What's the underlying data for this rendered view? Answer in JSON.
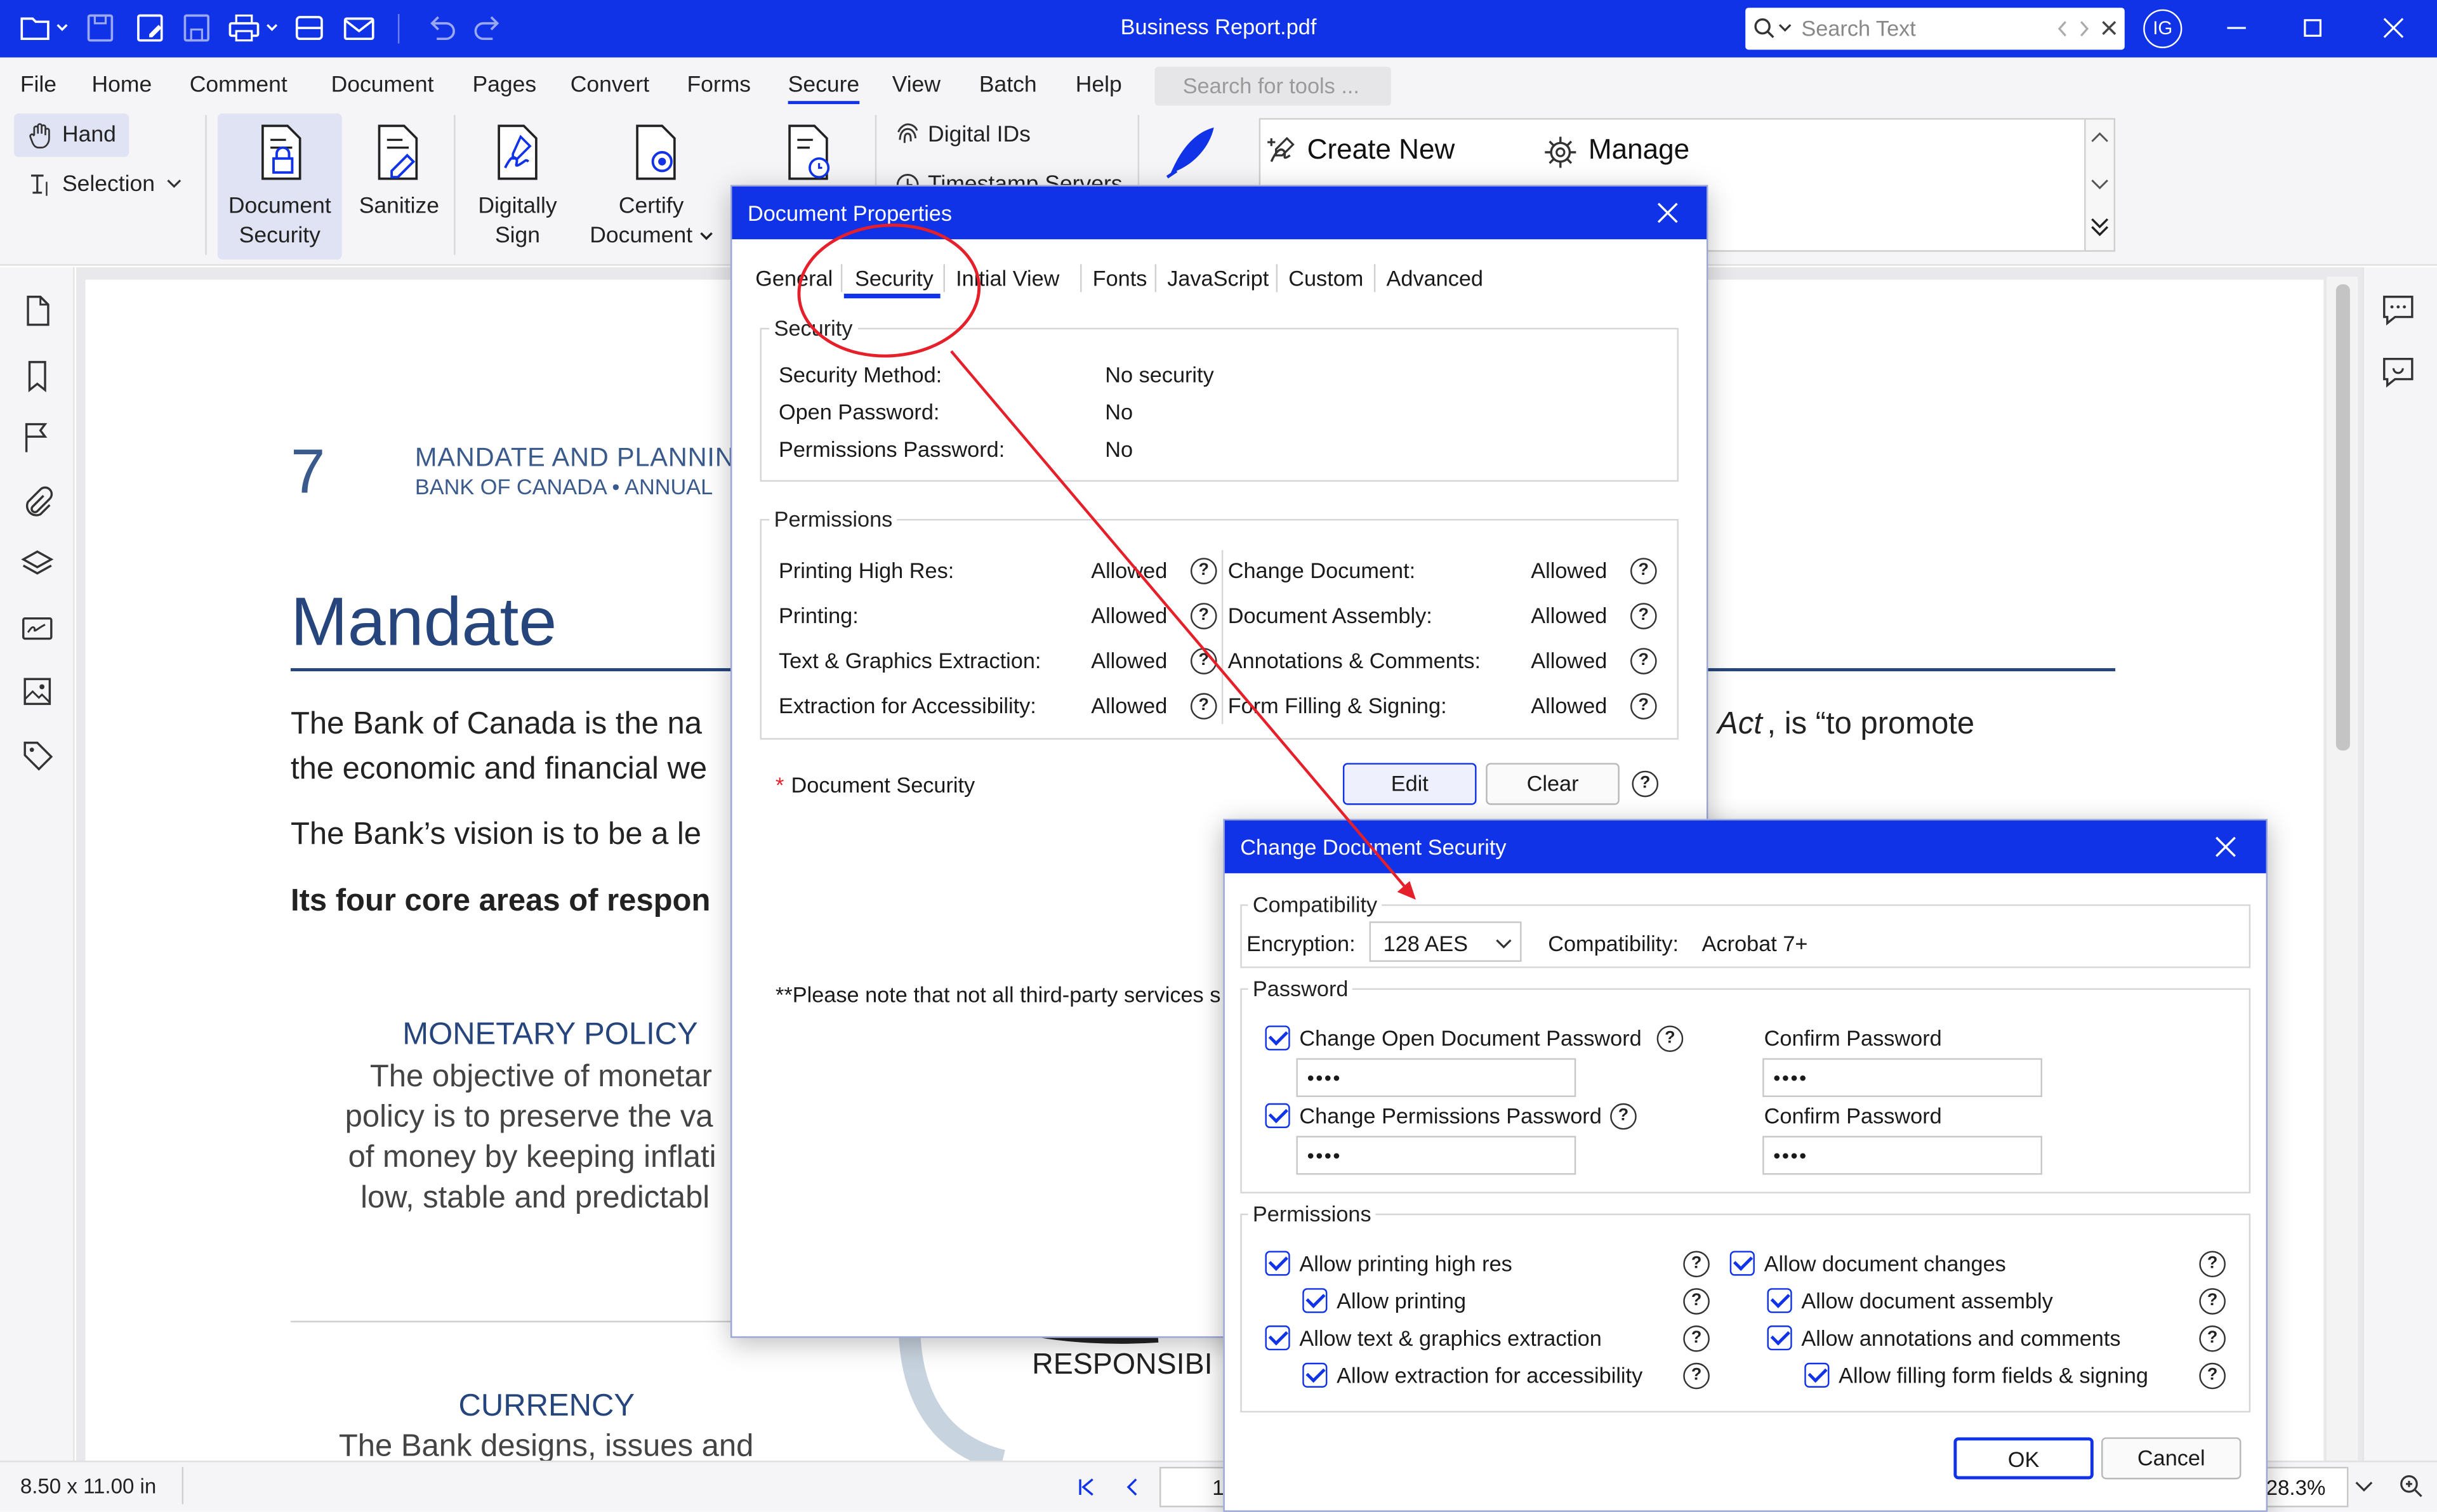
{
  "app": {
    "title": "Business Report.pdf",
    "search_placeholder": "Search Text",
    "avatar_initials": "IG",
    "accent": "#1033e8"
  },
  "menu": [
    "File",
    "Home",
    "Comment",
    "Document",
    "Pages",
    "Convert",
    "Forms",
    "Secure",
    "View",
    "Batch",
    "Help"
  ],
  "tools_search_placeholder": "Search for tools ...",
  "ribbon": {
    "hand": "Hand",
    "selection": "Selection",
    "document_security_1": "Document",
    "document_security_2": "Security",
    "sanitize": "Sanitize",
    "digitally_1": "Digitally",
    "digitally_2": "Sign",
    "certify_1": "Certify",
    "certify_2": "Document",
    "digital_ids": "Digital IDs",
    "timestamp_servers": "Timestamp Servers",
    "create_new": "Create New",
    "manage": "Manage"
  },
  "page": {
    "number": "7",
    "header1": "MANDATE AND PLANNIN",
    "header2": "BANK OF CANADA  •  ANNUAL",
    "heading": "Mandate",
    "p1a": "The Bank of Canada is the na",
    "p1b": "the economic and financial we",
    "p1c": "Act",
    "p1d": ", is “to promote",
    "p2": "The Bank’s vision is to be a le",
    "p3": "Its four core areas of respon",
    "mp_title": "MONETARY POLICY",
    "mp_l1": "The objective of monetar",
    "mp_l2": "policy is to preserve the va",
    "mp_l3": "of money by keeping inflati",
    "mp_l4": "low, stable and predictabl",
    "cur_title": "CURRENCY",
    "cur_l1": "The Bank designs, issues and",
    "resp": "RESPONSIBI"
  },
  "status": {
    "page_size": "8.50 x 11.00 in",
    "page_field": "1",
    "zoom": "28.3%"
  },
  "doc_properties": {
    "title": "Document Properties",
    "tabs": [
      "General",
      "Security",
      "Initial View",
      "Fonts",
      "JavaScript",
      "Custom",
      "Advanced"
    ],
    "active_tab": "Security",
    "security_legend": "Security",
    "security_rows": [
      {
        "label": "Security Method:",
        "value": "No security"
      },
      {
        "label": "Open Password:",
        "value": "No"
      },
      {
        "label": "Permissions Password:",
        "value": "No"
      }
    ],
    "permissions_legend": "Permissions",
    "perm_left": [
      {
        "label": "Printing High Res:",
        "value": "Allowed"
      },
      {
        "label": "Printing:",
        "value": "Allowed"
      },
      {
        "label": "Text & Graphics Extraction:",
        "value": "Allowed"
      },
      {
        "label": "Extraction for Accessibility:",
        "value": "Allowed"
      }
    ],
    "perm_right": [
      {
        "label": "Change Document:",
        "value": "Allowed"
      },
      {
        "label": "Document Assembly:",
        "value": "Allowed"
      },
      {
        "label": "Annotations & Comments:",
        "value": "Allowed"
      },
      {
        "label": "Form Filling & Signing:",
        "value": "Allowed"
      }
    ],
    "doc_security_label": "Document Security",
    "edit": "Edit",
    "clear": "Clear",
    "note": "**Please note that not all third-party services s"
  },
  "change_security": {
    "title": "Change Document Security",
    "compat_legend": "Compatibility",
    "encryption_label": "Encryption:",
    "encryption_value": "128 AES",
    "compat_label": "Compatibility:",
    "compat_value": "Acrobat 7+",
    "password_legend": "Password",
    "open_pwd_label": "Change Open Document Password",
    "perm_pwd_label": "Change Permissions Password",
    "confirm_label": "Confirm Password",
    "pwd_mask": "••••",
    "permissions_legend": "Permissions",
    "left_perms": [
      "Allow printing high res",
      "Allow printing",
      "Allow text & graphics extraction",
      "Allow extraction for accessibility"
    ],
    "right_perms": [
      "Allow document changes",
      "Allow document assembly",
      "Allow annotations and comments",
      "Allow filling form fields & signing"
    ],
    "ok": "OK",
    "cancel": "Cancel"
  },
  "annotation_color": "#e5202a"
}
